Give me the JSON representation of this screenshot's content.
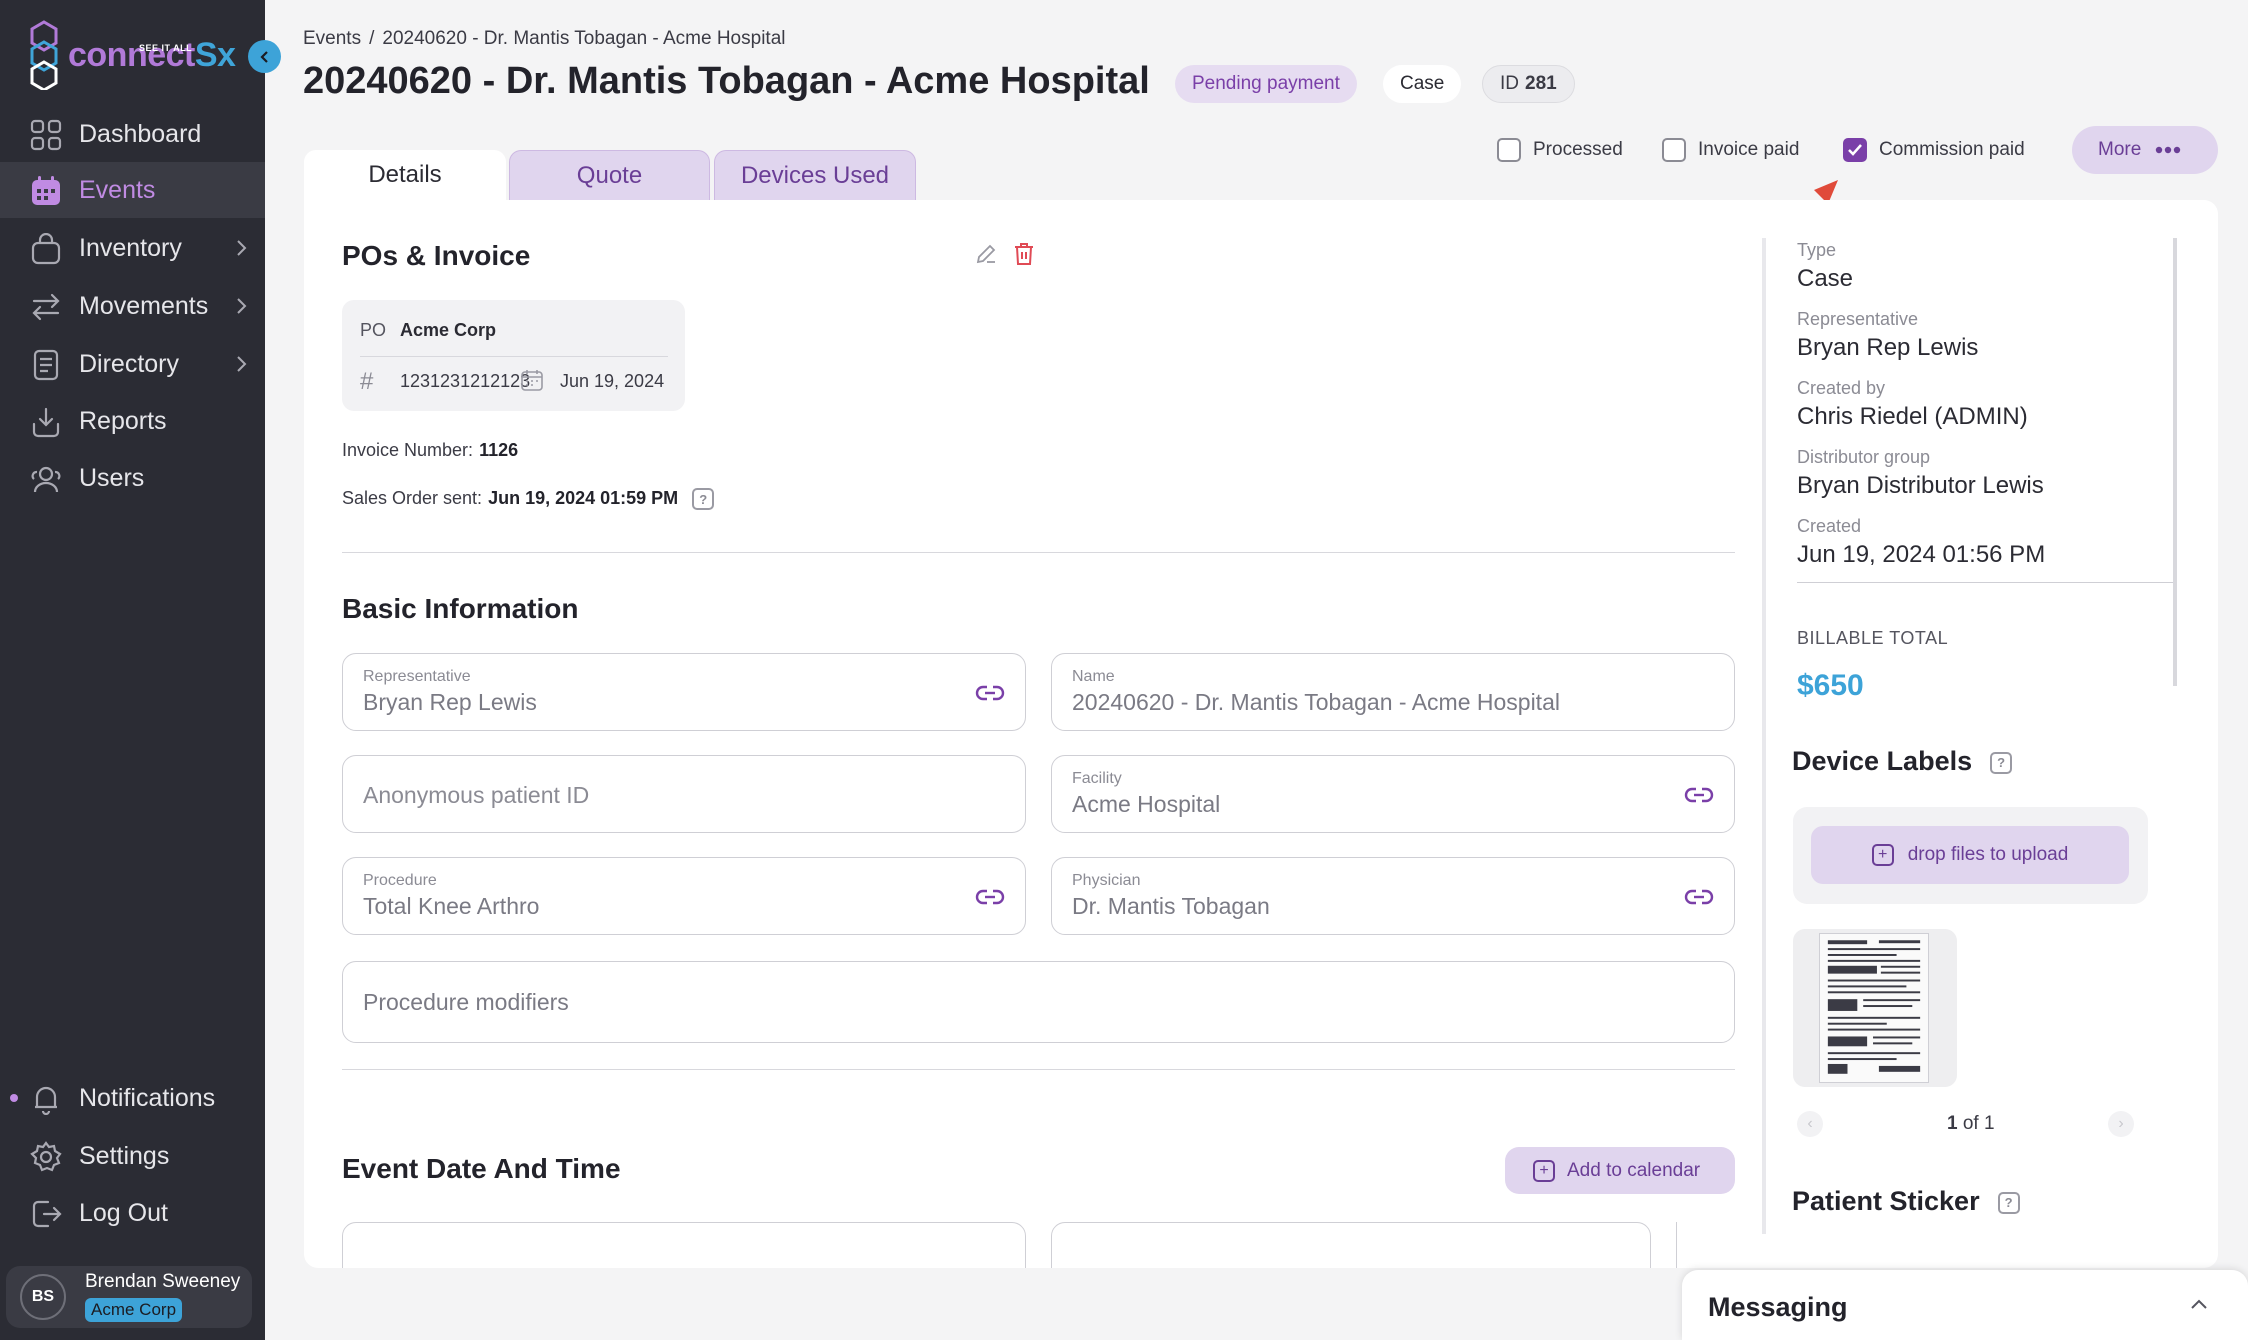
{
  "sidebar": {
    "logo_main": "connect",
    "logo_accent": "Sx",
    "logo_tagline": "SEE IT ALL",
    "nav": [
      {
        "label": "Dashboard",
        "icon": "dashboard-icon"
      },
      {
        "label": "Events",
        "icon": "calendar-icon",
        "active": true
      },
      {
        "label": "Inventory",
        "icon": "bag-icon"
      },
      {
        "label": "Movements",
        "icon": "arrows-icon"
      },
      {
        "label": "Directory",
        "icon": "book-icon"
      },
      {
        "label": "Reports",
        "icon": "download-icon"
      },
      {
        "label": "Users",
        "icon": "users-icon"
      }
    ],
    "bottom_nav": [
      {
        "label": "Notifications",
        "icon": "bell-icon"
      },
      {
        "label": "Settings",
        "icon": "gear-icon"
      },
      {
        "label": "Log Out",
        "icon": "logout-icon"
      }
    ],
    "user": {
      "initials": "BS",
      "name": "Brendan Sweeney",
      "org": "Acme Corp"
    }
  },
  "header": {
    "breadcrumb": [
      "Events",
      "20240620 - Dr. Mantis Tobagan - Acme Hospital"
    ],
    "breadcrumb_sep": "/",
    "title": "20240620 - Dr. Mantis Tobagan - Acme Hospital",
    "status_badge": "Pending payment",
    "type_badge": "Case",
    "id_label": "ID",
    "id_value": "281"
  },
  "tabs": [
    "Details",
    "Quote",
    "Devices Used"
  ],
  "flags": {
    "processed": {
      "label": "Processed",
      "checked": false
    },
    "invoice_paid": {
      "label": "Invoice paid",
      "checked": false
    },
    "commission_paid": {
      "label": "Commission paid",
      "checked": true
    },
    "more_label": "More"
  },
  "pos": {
    "title": "POs & Invoice",
    "po_label": "PO",
    "po_org": "Acme Corp",
    "po_number": "1231231212123",
    "po_date": "Jun 19, 2024",
    "invoice_label": "Invoice Number:",
    "invoice_value": "1126",
    "sales_order_label": "Sales Order sent:",
    "sales_order_value": "Jun 19, 2024 01:59 PM"
  },
  "basic": {
    "title": "Basic Information",
    "representative_label": "Representative",
    "representative_value": "Bryan Rep Lewis",
    "name_label": "Name",
    "name_value": "20240620 - Dr. Mantis Tobagan - Acme Hospital",
    "patient_placeholder": "Anonymous patient ID",
    "facility_label": "Facility",
    "facility_value": "Acme Hospital",
    "procedure_label": "Procedure",
    "procedure_value": "Total Knee Arthro",
    "physician_label": "Physician",
    "physician_value": "Dr. Mantis Tobagan",
    "modifiers_placeholder": "Procedure modifiers"
  },
  "event_date": {
    "title": "Event Date And Time",
    "add_calendar_label": "Add to calendar"
  },
  "summary": {
    "type_label": "Type",
    "type_value": "Case",
    "rep_label": "Representative",
    "rep_value": "Bryan Rep Lewis",
    "created_by_label": "Created by",
    "created_by_value": "Chris Riedel (ADMIN)",
    "dist_label": "Distributor group",
    "dist_value": "Bryan Distributor Lewis",
    "created_label": "Created",
    "created_value": "Jun 19, 2024 01:56 PM",
    "billable_label": "BILLABLE TOTAL",
    "billable_value": "$650"
  },
  "device_labels": {
    "title": "Device Labels",
    "upload_label": "drop files to upload",
    "page_current": "1",
    "page_of": "of 1"
  },
  "patient_sticker": {
    "title": "Patient Sticker"
  },
  "messaging": {
    "title": "Messaging"
  },
  "help_glyph": "?",
  "colors": {
    "accent": "#7a3fa8",
    "brand_blue": "#3da3d8",
    "sidebar": "#2b2c34",
    "annotation": "#e04a3a"
  }
}
